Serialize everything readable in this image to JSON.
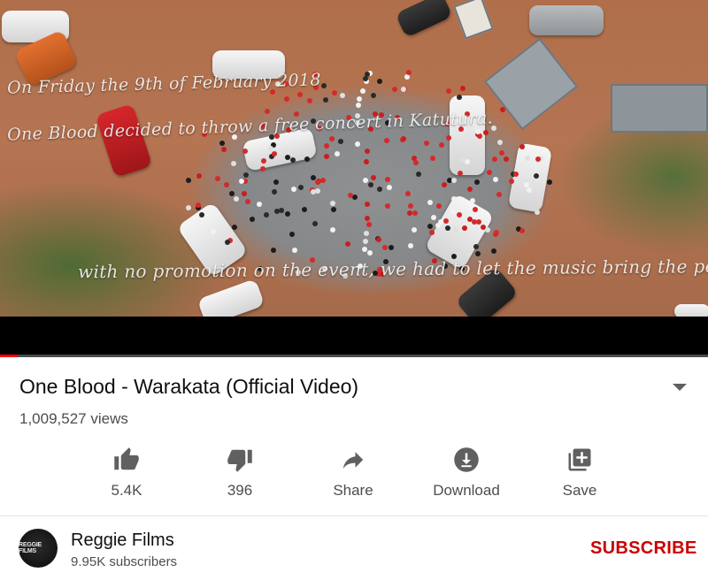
{
  "video": {
    "overlay_line_1": "On Friday the 9th of February 2018",
    "overlay_line_2": "One Blood decided to throw a free concert in Katutura.",
    "overlay_line_3": "with no promotion on the event, we had to let the music bring the people.",
    "progress_fraction": 0.025
  },
  "info": {
    "title": "One Blood - Warakata (Official Video)",
    "views": "1,009,527 views"
  },
  "actions": [
    {
      "icon": "thumbs-up-icon",
      "label": "5.4K"
    },
    {
      "icon": "thumbs-down-icon",
      "label": "396"
    },
    {
      "icon": "share-icon",
      "label": "Share"
    },
    {
      "icon": "download-icon",
      "label": "Download"
    },
    {
      "icon": "save-icon",
      "label": "Save"
    }
  ],
  "channel": {
    "avatar_text": "REGGIE FILMS",
    "name": "Reggie Films",
    "subscribers": "9.95K subscribers",
    "subscribe_label": "SUBSCRIBE"
  },
  "colors": {
    "accent_red": "#cc0000",
    "progress_red": "#ff0000",
    "icon_grey": "#606060"
  }
}
